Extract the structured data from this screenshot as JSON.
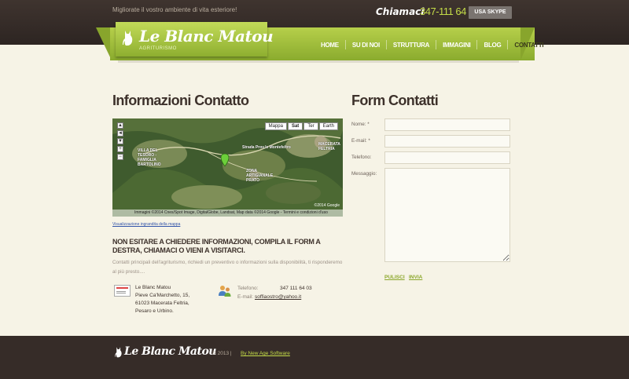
{
  "header": {
    "tagline": "Migliorate il vostro ambiente di vita esteriore!",
    "call_label": "Chiamaci",
    "phone": "347-111 64 03",
    "skype_button": "USA SKYPE",
    "logo_title": "Le Blanc Matou",
    "logo_subtitle": "AGRITURISMO"
  },
  "nav": {
    "items": [
      {
        "label": "HOME"
      },
      {
        "label": "SU DI NOI"
      },
      {
        "label": "STRUTTURA"
      },
      {
        "label": "IMMAGINI"
      },
      {
        "label": "BLOG"
      },
      {
        "label": "CONTATTI"
      }
    ],
    "active": "CONTATTI"
  },
  "contact_info": {
    "heading": "Informazioni Contatto",
    "map": {
      "types": [
        "Mappa",
        "Sat",
        "Ter",
        "Earth"
      ],
      "selected_type": "Sat",
      "footer_text": "Immagini ©2014 Cnes/Spot Image, DigitalGlobe, Landsat, Map data ©2014 Google - Termini e condizioni d'uso",
      "watermark": "©2014 Google",
      "labels": [
        "VILLA DEL TESORO - FAMIGLIA BARTOLINO",
        "Strada Prov.le Montefeltro",
        "ZONA ARTIGIANALE PRATO",
        "MACERATA FELTRIA"
      ]
    },
    "map_link": "Visualizzazione ingrandita della mappa",
    "cta": "NON ESITARE A CHIEDERE INFORMAZIONI, COMPILA IL FORM A DESTRA, CHIAMACI O VIENI A VISITARCI.",
    "intro": "Contatti principali dell'agriturismo, richiedi un preventivo o informazioni sulla disponibilità, ti risponderemo al più presto....",
    "address": [
      "Le Blanc Matou",
      "Pieve Ca'Marchetto, 15,",
      "61023 Macerata Feltria,",
      "Pesaro e Urbino."
    ],
    "phone_label": "Telefono:",
    "phone_value": "347 111 64 03",
    "email_label": "E-mail:",
    "email_value": "soffiaostro@yahoo.it"
  },
  "form": {
    "heading": "Form Contatti",
    "fields": [
      {
        "label": "Nome: *"
      },
      {
        "label": "E-mail: *"
      },
      {
        "label": "Telefono:"
      },
      {
        "label": "Messaggio:"
      }
    ],
    "clear_button": "PULISCI",
    "submit_button": "INVIA"
  },
  "footer": {
    "logo": "Le Blanc Matou",
    "copyright": "© 2013 |",
    "credit": "By New Age Software"
  },
  "colors": {
    "accent_green": "#9ab93a",
    "dark_brown": "#362c28",
    "background": "#f6f3e6"
  }
}
